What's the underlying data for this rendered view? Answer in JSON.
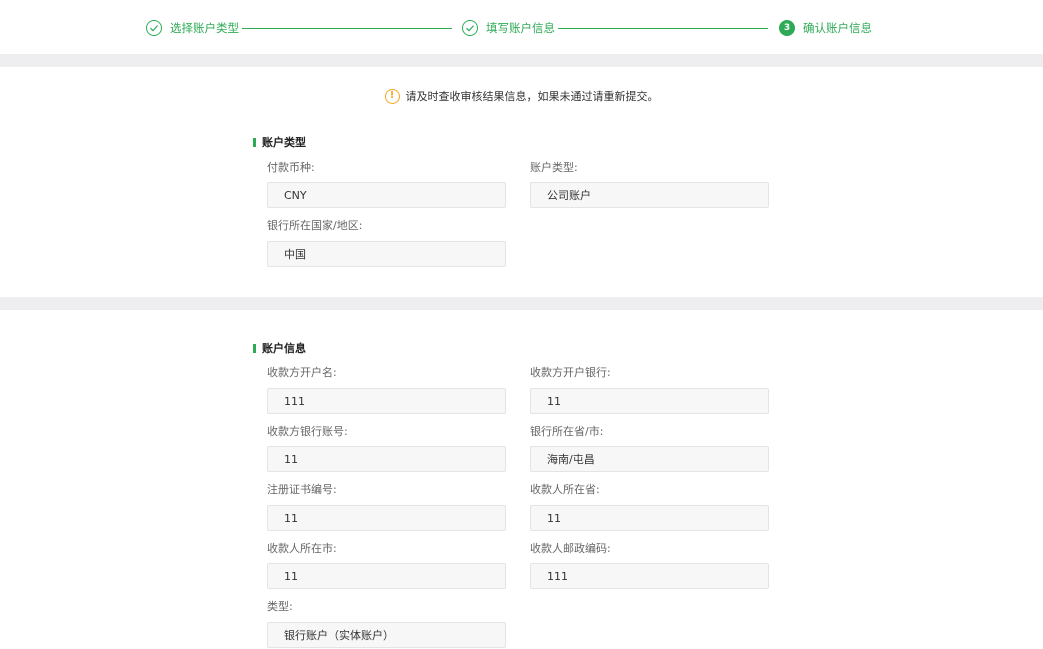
{
  "steps": [
    {
      "label": "选择账户类型",
      "state": "done"
    },
    {
      "label": "填写账户信息",
      "state": "done"
    },
    {
      "label": "确认账户信息",
      "state": "active",
      "number": "3"
    }
  ],
  "notice": {
    "icon": "warning-icon",
    "text": "请及时查收审核结果信息，如果未通过请重新提交。"
  },
  "account_type_section": {
    "title": "账户类型",
    "fields": [
      {
        "label": "付款币种:",
        "value": "CNY"
      },
      {
        "label": "账户类型:",
        "value": "公司账户"
      },
      {
        "label": "银行所在国家/地区:",
        "value": "中国"
      }
    ]
  },
  "account_info_section": {
    "title": "账户信息",
    "fields": [
      {
        "label": "收款方开户名:",
        "value": "111"
      },
      {
        "label": "收款方开户银行:",
        "value": "11"
      },
      {
        "label": "收款方银行账号:",
        "value": "11"
      },
      {
        "label": "银行所在省/市:",
        "value": "海南/屯昌"
      },
      {
        "label": "注册证书编号:",
        "value": "11"
      },
      {
        "label": "收款人所在省:",
        "value": "11"
      },
      {
        "label": "收款人所在市:",
        "value": "11"
      },
      {
        "label": "收款人邮政编码:",
        "value": "111"
      },
      {
        "label": "类型:",
        "value": "银行账户（实体账户）"
      }
    ]
  },
  "colors": {
    "accent": "#2eaa56",
    "warning": "#f5a623",
    "band": "#eeeef1"
  }
}
